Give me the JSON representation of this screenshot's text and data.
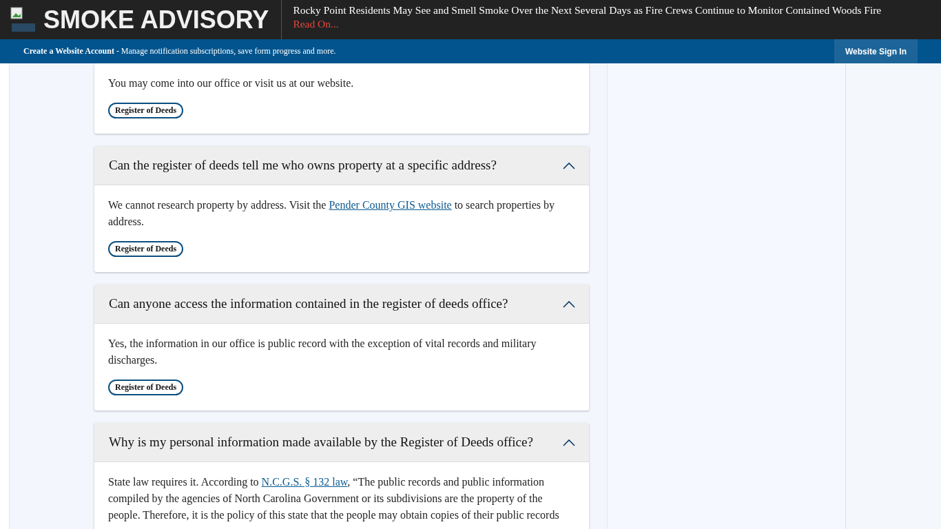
{
  "alert": {
    "title": "SMOKE ADVISORY",
    "headline": "Rocky Point Residents May See and Smell Smoke Over the Next Several Days as Fire Crews Continue to Monitor Contained Woods Fire",
    "link": "Read On..."
  },
  "account_bar": {
    "title": "Create a Website Account",
    "text": " - Manage notification subscriptions, save form progress and more.",
    "sign_in": "Website Sign In"
  },
  "faqs": [
    {
      "body": [
        {
          "kind": "text",
          "text": "You may come into our office or visit us at our website."
        }
      ],
      "tag": "Register of Deeds"
    },
    {
      "question": "Can the register of deeds tell me who owns property at a specific address?",
      "expanded": true,
      "body": [
        {
          "kind": "text",
          "text": "We cannot research property by address. Visit the "
        },
        {
          "kind": "link",
          "text": "Pender County GIS website"
        },
        {
          "kind": "text",
          "text": " to search properties by address."
        }
      ],
      "tag": "Register of Deeds"
    },
    {
      "question": "Can anyone access the information contained in the register of deeds office?",
      "expanded": true,
      "body": [
        {
          "kind": "text",
          "text": "Yes, the information in our office is public record with the exception of vital records and military discharges."
        }
      ],
      "tag": "Register of Deeds"
    },
    {
      "question": "Why is my personal information made available by the Register of Deeds office?",
      "expanded": true,
      "body": [
        {
          "kind": "text",
          "text": "State law requires it.  According to "
        },
        {
          "kind": "link",
          "text": "N.C.G.S. § 132 law"
        },
        {
          "kind": "text",
          "text": ", “The public records and public information compiled by the agencies of North Carolina Government or its subdivisions are the property of the people. Therefore, it is the policy of this state that the people may obtain copies of their public records"
        }
      ]
    }
  ]
}
